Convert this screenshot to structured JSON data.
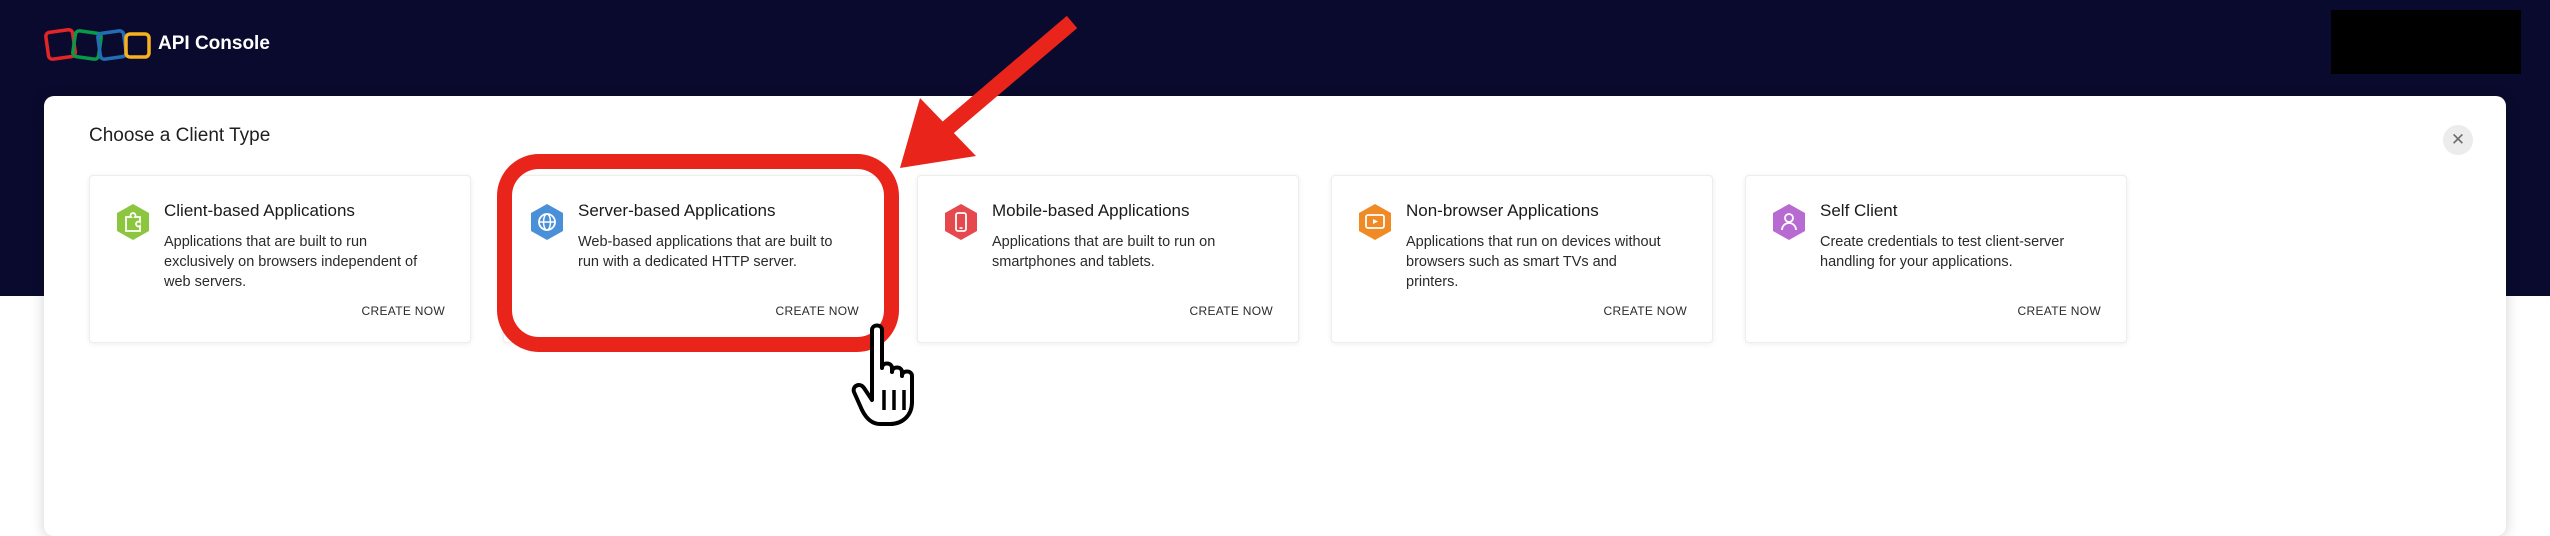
{
  "header": {
    "title": "API Console"
  },
  "dialog": {
    "title": "Choose a Client Type",
    "close_icon": "close-icon"
  },
  "client_types": [
    {
      "title": "Client-based Applications",
      "description": "Applications that are built to run exclusively on browsers independent of web servers.",
      "cta": "CREATE NOW",
      "icon": "puzzle-icon",
      "color": "#8cc63f"
    },
    {
      "title": "Server-based Applications",
      "description": "Web-based applications that are built to run with a dedicated HTTP server.",
      "cta": "CREATE NOW",
      "icon": "globe-icon",
      "color": "#4a90d9"
    },
    {
      "title": "Mobile-based Applications",
      "description": "Applications that are built to run on smartphones and tablets.",
      "cta": "CREATE NOW",
      "icon": "mobile-icon",
      "color": "#e5484d"
    },
    {
      "title": "Non-browser Applications",
      "description": "Applications that run on devices without browsers such as smart TVs and printers.",
      "cta": "CREATE NOW",
      "icon": "tv-icon",
      "color": "#f08a24"
    },
    {
      "title": "Self Client",
      "description": "Create credentials to test client-server handling for your applications.",
      "cta": "CREATE NOW",
      "icon": "user-icon",
      "color": "#b86ad3"
    }
  ],
  "colors": {
    "header_bg": "#0a0a2e",
    "highlight": "#e8241b"
  }
}
